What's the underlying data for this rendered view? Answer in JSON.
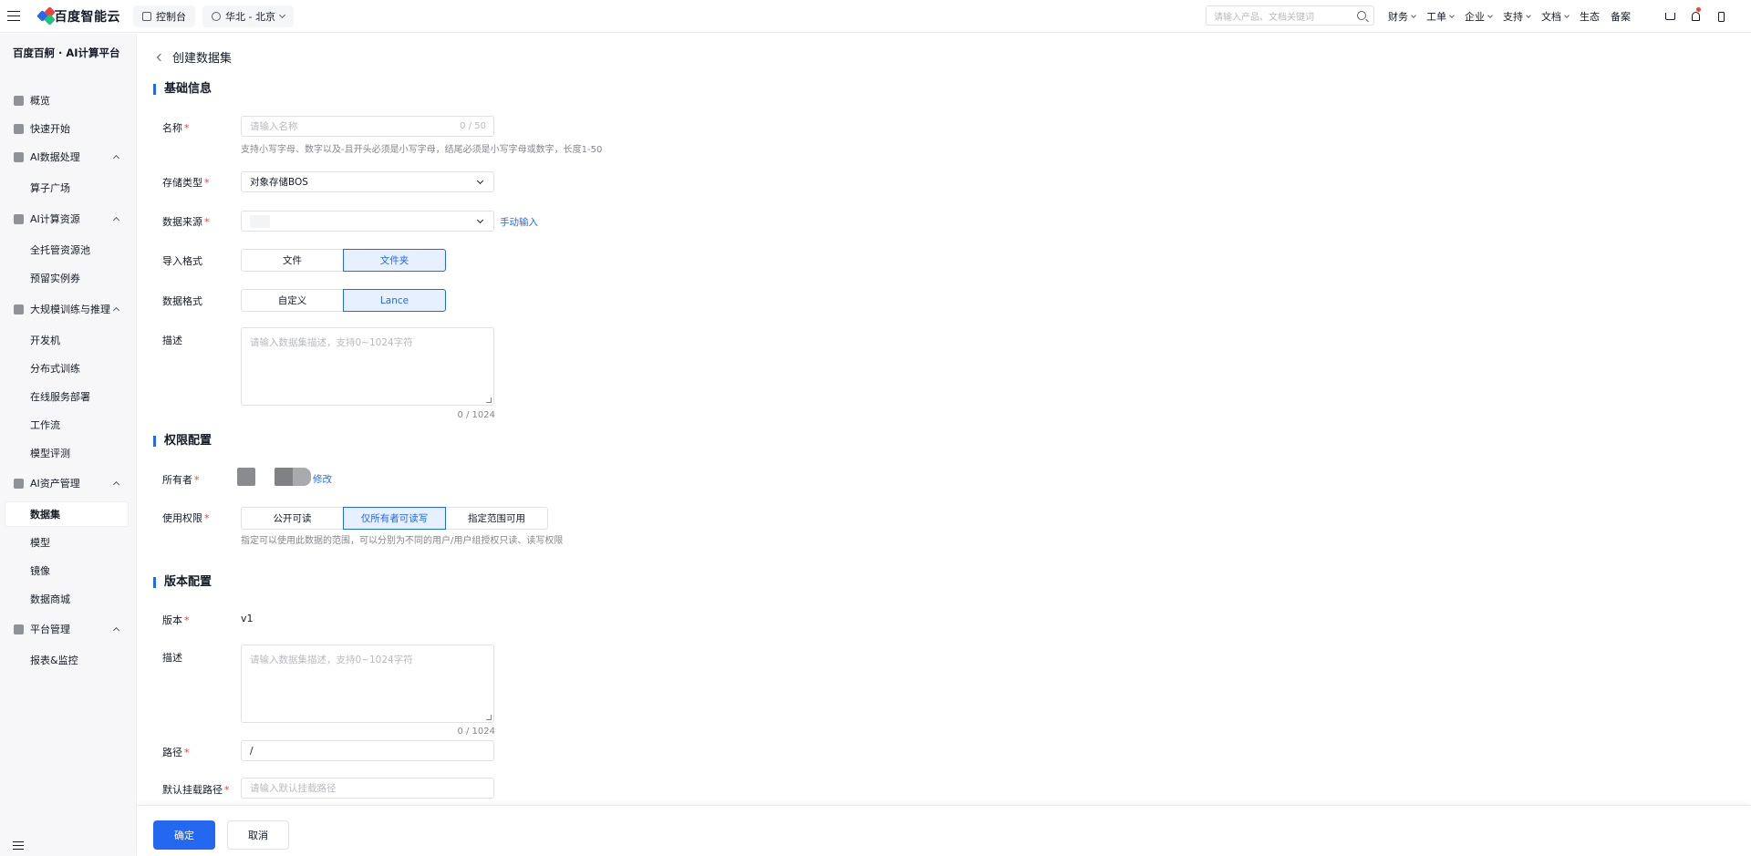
{
  "topbar": {
    "brand": "百度智能云",
    "console": "控制台",
    "region": "华北 - 北京",
    "search_placeholder": "请输入产品、文档关键词",
    "menu": [
      "财务",
      "工单",
      "企业",
      "支持",
      "文档",
      "生态",
      "备案"
    ],
    "menu_has_dropdown": [
      true,
      true,
      true,
      true,
      true,
      false,
      false
    ]
  },
  "sidebar": {
    "title": "百度百舸 · AI计算平台",
    "items": [
      {
        "label": "概览",
        "type": "top",
        "icon": "home-icon"
      },
      {
        "label": "快速开始",
        "type": "top",
        "icon": "rocket-icon"
      },
      {
        "label": "AI数据处理",
        "type": "group",
        "icon": "data-process-icon"
      },
      {
        "label": "算子广场",
        "type": "sub"
      },
      {
        "label": "AI计算资源",
        "type": "group",
        "icon": "server-icon"
      },
      {
        "label": "全托管资源池",
        "type": "sub"
      },
      {
        "label": "预留实例券",
        "type": "sub"
      },
      {
        "label": "大规模训练与推理",
        "type": "group",
        "icon": "training-icon"
      },
      {
        "label": "开发机",
        "type": "sub"
      },
      {
        "label": "分布式训练",
        "type": "sub"
      },
      {
        "label": "在线服务部署",
        "type": "sub"
      },
      {
        "label": "工作流",
        "type": "sub"
      },
      {
        "label": "模型评测",
        "type": "sub"
      },
      {
        "label": "AI资产管理",
        "type": "group",
        "icon": "asset-icon"
      },
      {
        "label": "数据集",
        "type": "sub",
        "active": true
      },
      {
        "label": "模型",
        "type": "sub"
      },
      {
        "label": "镜像",
        "type": "sub"
      },
      {
        "label": "数据商城",
        "type": "sub"
      },
      {
        "label": "平台管理",
        "type": "group",
        "icon": "layers-icon"
      },
      {
        "label": "报表&监控",
        "type": "sub"
      }
    ]
  },
  "page": {
    "title": "创建数据集"
  },
  "basic": {
    "section_title": "基础信息",
    "name_label": "名称",
    "name_placeholder": "请输入名称",
    "name_count": "0 / 50",
    "name_hint": "支持小写字母、数字以及-且开头必须是小写字母，结尾必须是小写字母或数字，长度1-50",
    "storage_label": "存储类型",
    "storage_value": "对象存储BOS",
    "source_label": "数据来源",
    "source_link": "手动输入",
    "import_label": "导入格式",
    "import_options": [
      "文件",
      "文件夹"
    ],
    "import_selected": 1,
    "format_label": "数据格式",
    "format_options": [
      "自定义",
      "Lance"
    ],
    "format_selected": 1,
    "desc_label": "描述",
    "desc_placeholder": "请输入数据集描述，支持0~1024字符",
    "desc_count": "0 / 1024"
  },
  "permission": {
    "section_title": "权限配置",
    "owner_label": "所有者",
    "owner_edit": "修改",
    "usage_label": "使用权限",
    "usage_options": [
      "公开可读",
      "仅所有者可读写",
      "指定范围可用"
    ],
    "usage_selected": 1,
    "usage_hint": "指定可以使用此数据的范围，可以分别为不同的用户/用户组授权只读、读写权限"
  },
  "version": {
    "section_title": "版本配置",
    "version_label": "版本",
    "version_value": "v1",
    "desc_label": "描述",
    "desc_placeholder": "请输入数据集描述，支持0~1024字符",
    "desc_count": "0 / 1024",
    "path_label": "路径",
    "path_value": "/",
    "mount_label": "默认挂载路径",
    "mount_placeholder": "请输入默认挂载路径"
  },
  "footer": {
    "confirm": "确定",
    "cancel": "取消"
  },
  "colors": {
    "accent": "#2468f2",
    "required": "#f33e3e",
    "selected_bg": "#e6f0ff"
  }
}
